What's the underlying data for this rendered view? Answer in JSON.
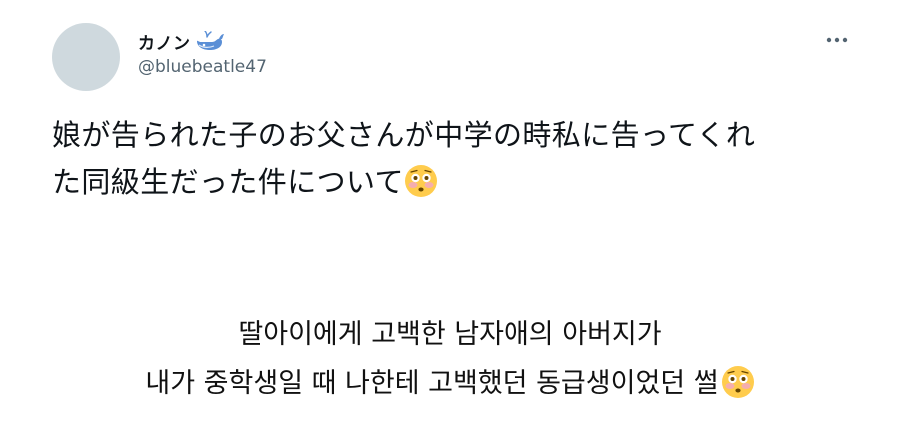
{
  "tweet": {
    "display_name": "カノン",
    "badge_icon": "whale-icon",
    "handle": "@bluebeatle47",
    "more_icon": "more-options-icon",
    "text_line1": "娘が告られた子のお父さんが中学の時私に告ってくれ",
    "text_line2": "た同級生だった件について",
    "emoji": "flushed-face-emoji"
  },
  "translation": {
    "line1": "딸아이에게 고백한 남자애의 아버지가",
    "line2": "내가 중학생일 때 나한테 고백했던 동급생이었던 썰",
    "emoji": "flushed-face-emoji"
  },
  "colors": {
    "avatar": "#cfd9de",
    "handle": "#536471",
    "text": "#0f1419",
    "whale": "#5b8fd6"
  }
}
